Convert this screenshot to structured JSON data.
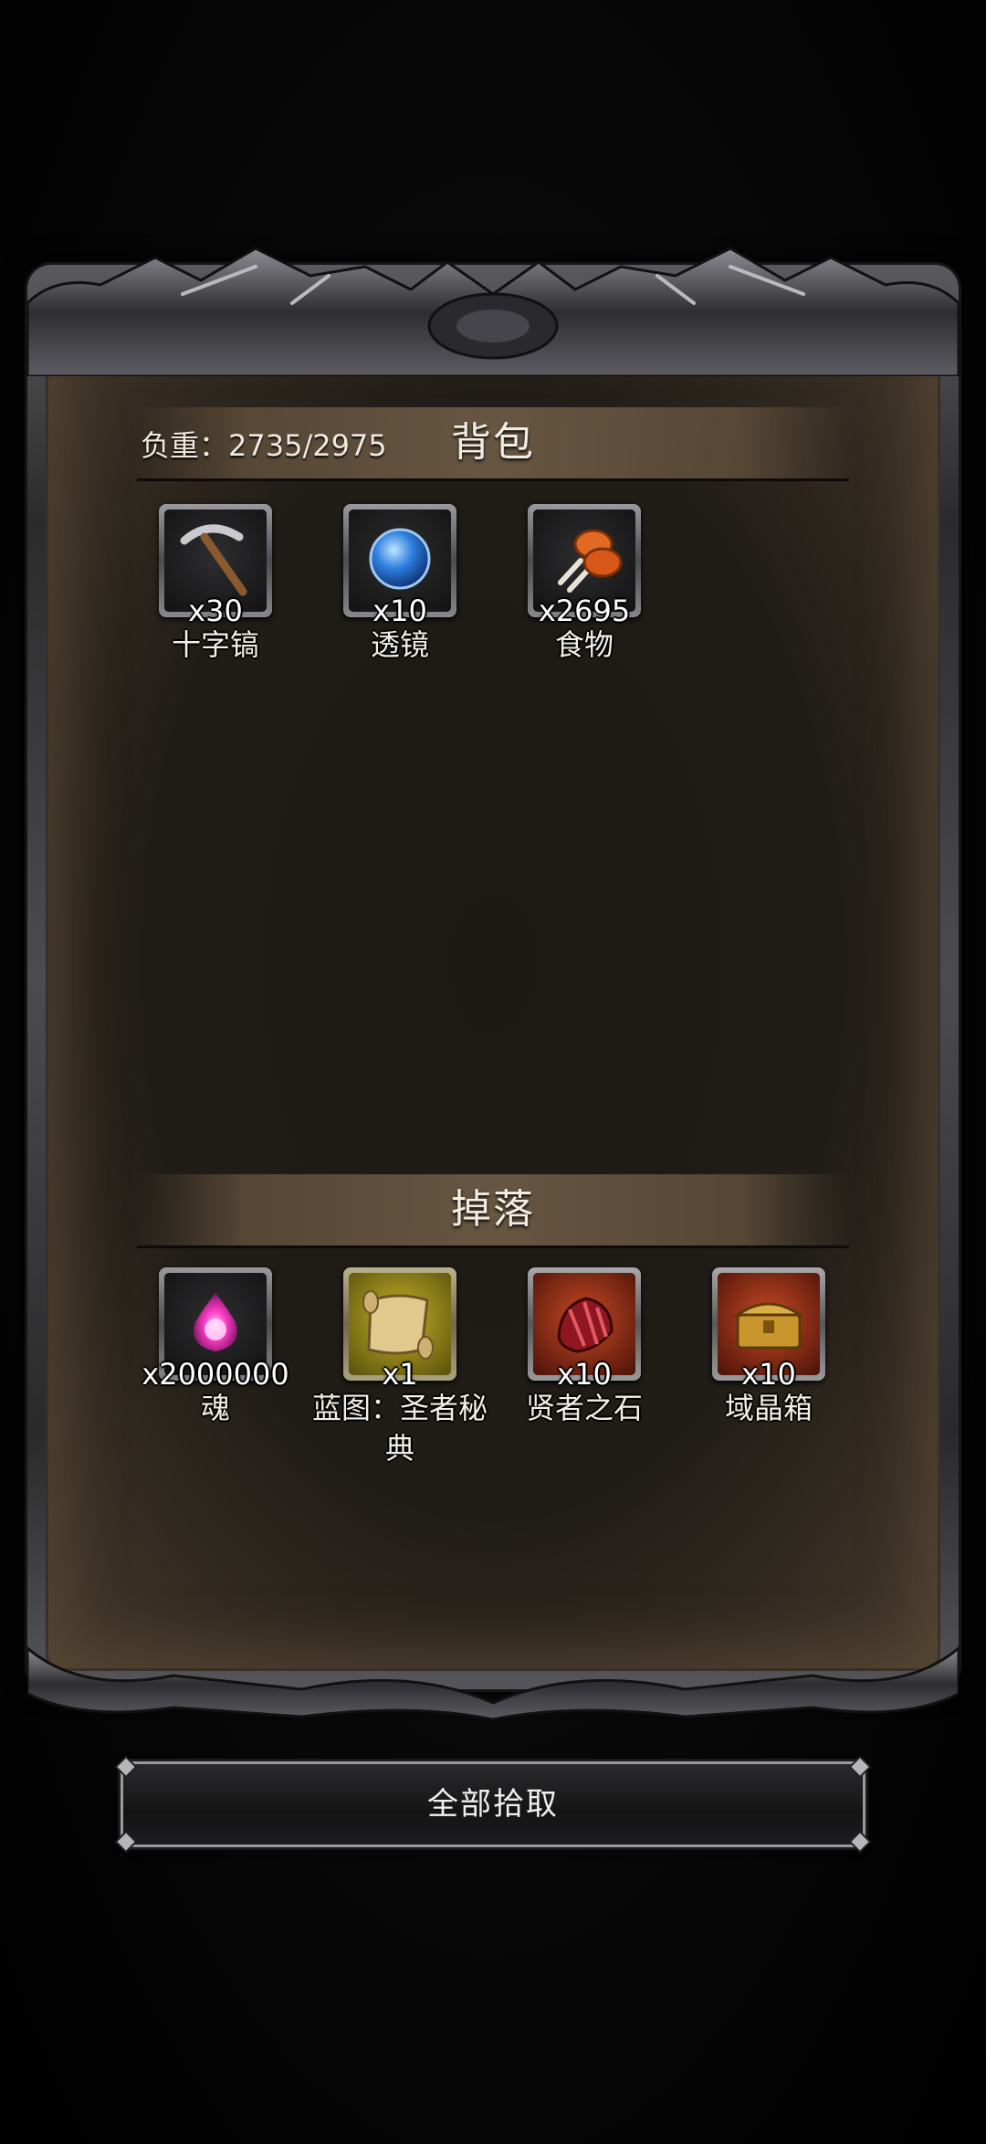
{
  "backpack": {
    "title": "背包",
    "weight_label": "负重：2735/2975",
    "items": [
      {
        "name": "十字镐",
        "count": "x30",
        "icon": "pickaxe-icon"
      },
      {
        "name": "透镜",
        "count": "x10",
        "icon": "lens-icon"
      },
      {
        "name": "食物",
        "count": "x2695",
        "icon": "food-icon"
      }
    ]
  },
  "drops": {
    "title": "掉落",
    "items": [
      {
        "name": "魂",
        "count": "x2000000",
        "icon": "soul-icon",
        "quality": "normal"
      },
      {
        "name": "蓝图：圣者秘典",
        "count": "x1",
        "icon": "scroll-icon",
        "quality": "gold"
      },
      {
        "name": "贤者之石",
        "count": "x10",
        "icon": "red-stone-icon",
        "quality": "red"
      },
      {
        "name": "域晶箱",
        "count": "x10",
        "icon": "treasure-chest-icon",
        "quality": "red"
      }
    ]
  },
  "actions": {
    "pickup_all_label": "全部拾取"
  }
}
